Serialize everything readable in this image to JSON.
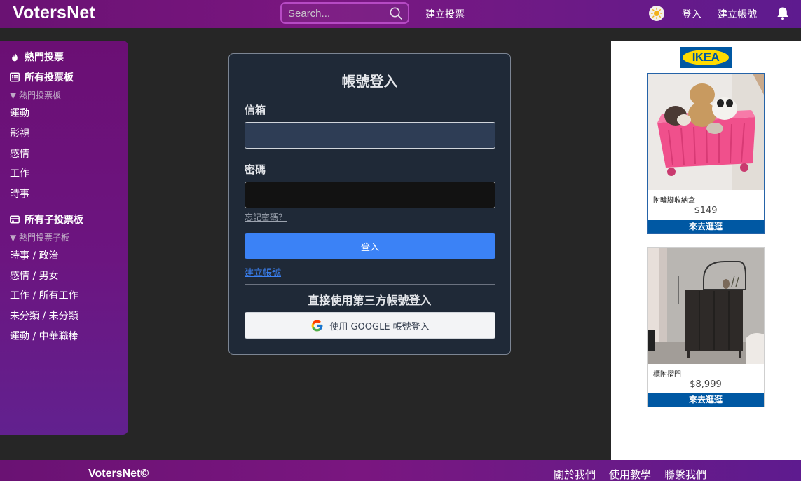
{
  "header": {
    "brand": "VotersNet",
    "search_placeholder": "Search...",
    "create_poll": "建立投票",
    "login": "登入",
    "register": "建立帳號"
  },
  "sidebar": {
    "hot_polls": "熱門投票",
    "all_boards": "所有投票板",
    "hot_boards_label": "▼ 熱門投票板",
    "boards": [
      "運動",
      "影視",
      "感情",
      "工作",
      "時事"
    ],
    "all_sub_boards": "所有子投票板",
    "hot_sub_boards_label": "▼ 熱門投票子板",
    "sub_boards": [
      "時事 / 政治",
      "感情 / 男女",
      "工作 / 所有工作",
      "未分類 / 未分類",
      "運動 / 中華職棒"
    ]
  },
  "login_card": {
    "title": "帳號登入",
    "email_label": "信箱",
    "email_value": "",
    "password_label": "密碼",
    "password_value": "",
    "forgot": "忘記密碼？",
    "submit": "登入",
    "create_account": "建立帳號",
    "third_party_title": "直接使用第三方帳號登入",
    "google_button": "使用 GOOGLE 帳號登入"
  },
  "ads": {
    "brand_logo": "IKEA",
    "products": [
      {
        "name": "附輪腳收納盒",
        "price": "$149",
        "cta": "來去逛逛"
      },
      {
        "name": "櫃附摺門",
        "price": "$8,999",
        "cta": "來去逛逛"
      }
    ]
  },
  "footer": {
    "brand": "VotersNet©",
    "links": [
      "關於我們",
      "使用教學",
      "聯繫我們"
    ]
  },
  "colors": {
    "header_purple": "#6a1273",
    "card_bg": "#1f2937",
    "primary_blue": "#3b82f6",
    "ikea_blue": "#0058a3",
    "ikea_yellow": "#ffdb00"
  }
}
